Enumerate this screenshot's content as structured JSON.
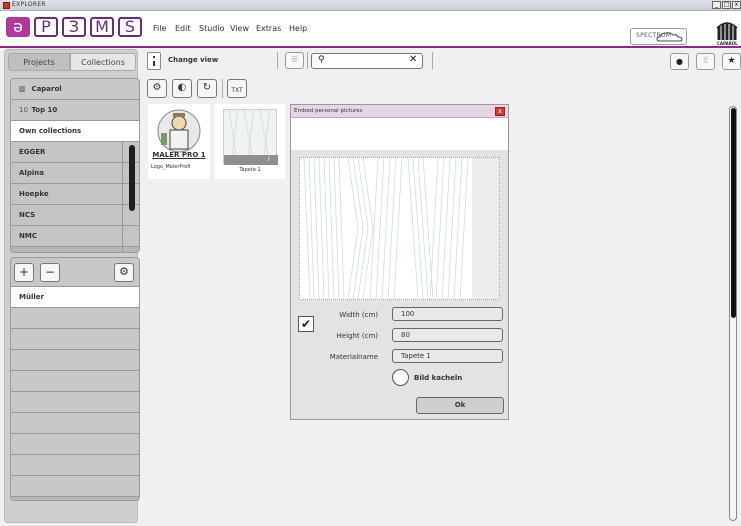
{
  "window": {
    "title": "EXPLORER"
  },
  "logo": {
    "letters": [
      "ə",
      "P",
      "З",
      "M",
      "S"
    ]
  },
  "menu": [
    "File",
    "Edit",
    "Studio",
    "View",
    "Extras",
    "Help"
  ],
  "header_right": {
    "spectrum_label": "SPECTRUM",
    "brand": "CAPAROL"
  },
  "left_tabs": {
    "projects": "Projects",
    "collections": "Collections"
  },
  "collections_list": [
    {
      "label": "Caparol",
      "icon": "brand-icon"
    },
    {
      "label": "Top 10",
      "icon": "top10-icon"
    },
    {
      "label": "Own collections",
      "selected": true
    },
    {
      "label": "EGGER"
    },
    {
      "label": "Alpina"
    },
    {
      "label": "Hoepke"
    },
    {
      "label": "NCS"
    },
    {
      "label": "NMC"
    }
  ],
  "top10_prefix": "10",
  "own_list": [
    {
      "label": "Müller",
      "selected": true
    }
  ],
  "toolbar": {
    "change_view": "Change view",
    "search_placeholder": "",
    "search_value": ""
  },
  "thumbnails": [
    {
      "caption": "Logo_MalerProfi",
      "overlay": "MALER PRO 1"
    },
    {
      "caption": "Tapete 1"
    }
  ],
  "dialog": {
    "title": "Embed personal pictures",
    "close": "x",
    "width_label": "Width (cm)",
    "width_value": "100",
    "height_label": "Height (cm)",
    "height_value": "80",
    "material_label": "Materialname",
    "material_value": "Tapete 1",
    "tile_label": "Bild kacheln",
    "ok_label": "Ok"
  },
  "colors": {
    "accent": "#8a2a8f",
    "logo_fill": "#b03a9a",
    "close_red": "#d04030"
  }
}
